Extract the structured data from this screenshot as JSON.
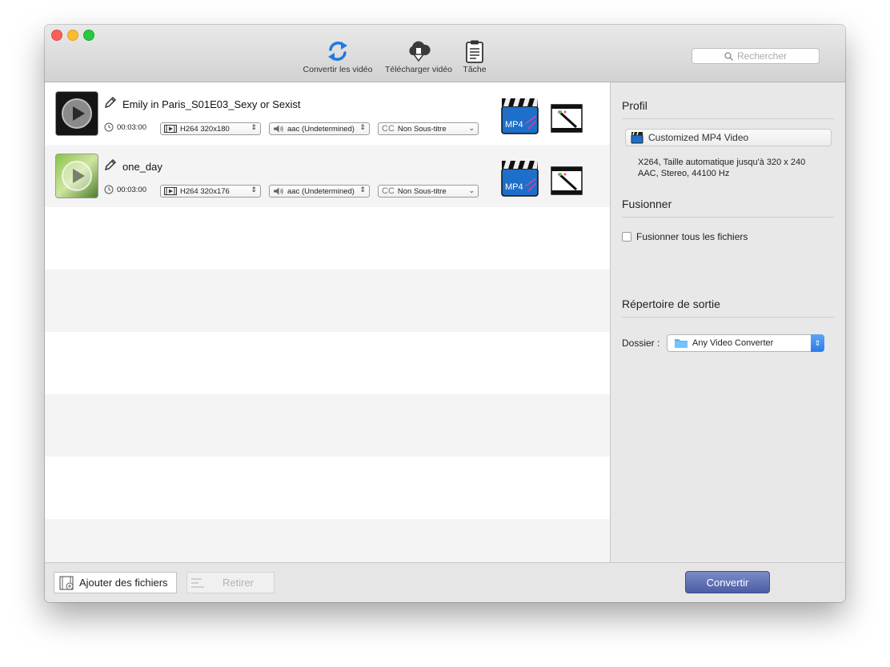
{
  "toolbar": {
    "convert_label": "Convertir les vidéo",
    "download_label": "Télécharger vidéo",
    "task_label": "Tâche",
    "search_placeholder": "Rechercher"
  },
  "files": [
    {
      "name": "Emily in Paris_S01E03_Sexy or Sexist",
      "duration": "00:03:00",
      "video": "H264 320x180",
      "audio": "aac (Undetermined)",
      "subtitle": "Non Sous-titre",
      "subtitle_icon": "CC"
    },
    {
      "name": "one_day",
      "duration": "00:03:00",
      "video": "H264 320x176",
      "audio": "aac (Undetermined)",
      "subtitle": "Non Sous-titre",
      "subtitle_icon": "CC"
    }
  ],
  "format_badge": "MP4",
  "sidebar": {
    "profile_title": "Profil",
    "profile_value": "Customized MP4 Video",
    "profile_desc_line1": "X264, Taille automatique jusqu'à 320 x 240",
    "profile_desc_line2": "AAC, Stereo, 44100 Hz",
    "merge_title": "Fusionner",
    "merge_checkbox_label": "Fusionner tous les fichiers",
    "merge_checked": false,
    "output_title": "Répertoire de sortie",
    "folder_label": "Dossier :",
    "folder_value": "Any Video Converter"
  },
  "bottom": {
    "add_label": "Ajouter des fichiers",
    "remove_label": "Retirer",
    "convert_label": "Convertir"
  },
  "colors": {
    "accent_blue": "#2a7bea",
    "convert_button": "#5a6aae"
  }
}
